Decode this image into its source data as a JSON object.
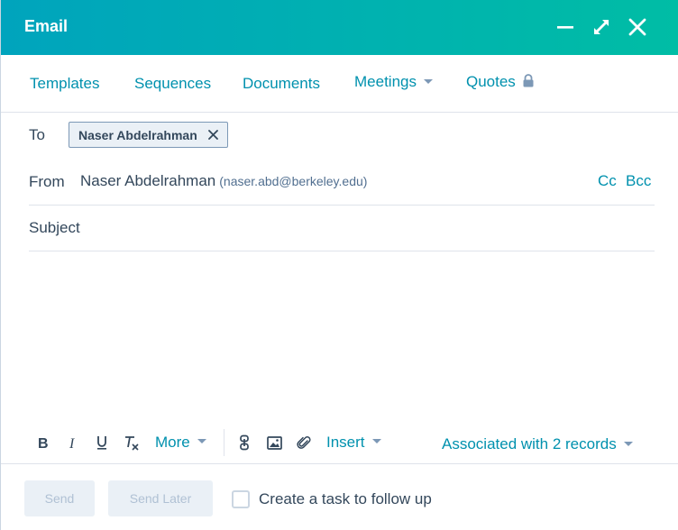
{
  "header": {
    "title": "Email",
    "minimize_icon": "minimize-icon",
    "expand_icon": "expand-icon",
    "close_icon": "close-icon"
  },
  "tabs": [
    {
      "label": "Templates"
    },
    {
      "label": "Sequences"
    },
    {
      "label": "Documents"
    },
    {
      "label": "Meetings",
      "has_dropdown": true
    },
    {
      "label": "Quotes",
      "locked": true
    }
  ],
  "to": {
    "label": "To",
    "recipient": "Naser Abdelrahman"
  },
  "from": {
    "label": "From",
    "name": "Naser Abdelrahman",
    "email": "(naser.abd@berkeley.edu)",
    "cc": "Cc",
    "bcc": "Bcc"
  },
  "subject": {
    "label": "Subject",
    "value": ""
  },
  "toolbar": {
    "more": "More",
    "insert": "Insert",
    "associated": "Associated with 2 records"
  },
  "footer": {
    "send": "Send",
    "send_later": "Send Later",
    "task_label": "Create a task to follow up"
  },
  "colors": {
    "accent": "#0091ae",
    "header_start": "#00a4bd",
    "header_end": "#00bda5",
    "text": "#33475b"
  }
}
